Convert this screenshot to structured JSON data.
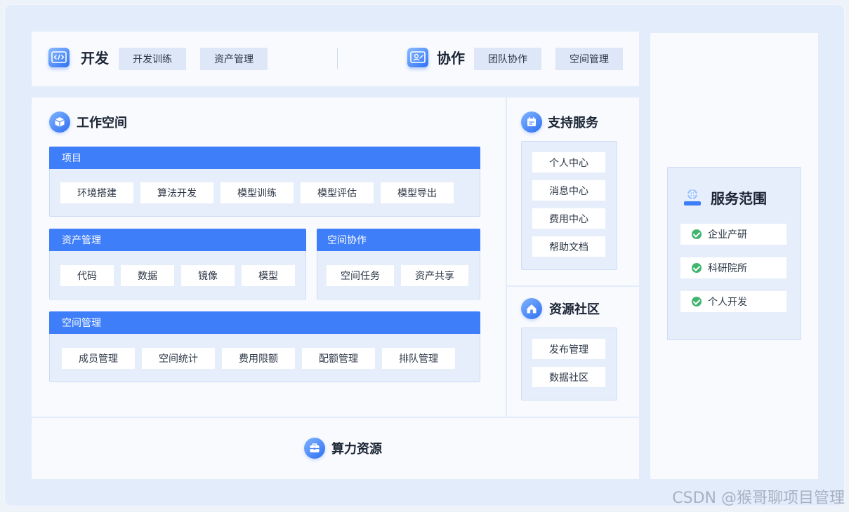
{
  "top_bar": {
    "develop": {
      "title": "开发",
      "chips": [
        "开发训练",
        "资产管理"
      ]
    },
    "collab": {
      "title": "协作",
      "chips": [
        "团队协作",
        "空间管理"
      ]
    }
  },
  "workspace": {
    "title": "工作空间",
    "project": {
      "header": "项目",
      "items": [
        "环境搭建",
        "算法开发",
        "模型训练",
        "模型评估",
        "模型导出"
      ]
    },
    "assets": {
      "header": "资产管理",
      "items": [
        "代码",
        "数据",
        "镜像",
        "模型"
      ]
    },
    "space_collab": {
      "header": "空间协作",
      "items": [
        "空间任务",
        "资产共享"
      ]
    },
    "space_mgmt": {
      "header": "空间管理",
      "items": [
        "成员管理",
        "空间统计",
        "费用限额",
        "配额管理",
        "排队管理"
      ]
    }
  },
  "support": {
    "title": "支持服务",
    "items": [
      "个人中心",
      "消息中心",
      "费用中心",
      "帮助文档"
    ]
  },
  "community": {
    "title": "资源社区",
    "items": [
      "发布管理",
      "数据社区"
    ]
  },
  "compute": {
    "title": "算力资源"
  },
  "scope": {
    "title": "服务范围",
    "items": [
      "企业产研",
      "科研院所",
      "个人开发"
    ]
  },
  "watermark": "CSDN @猴哥聊项目管理",
  "colors": {
    "accent": "#3e7ef8",
    "background": "#e3ecfb",
    "check": "#3fb56f"
  },
  "icons": {
    "develop": "code-window-icon",
    "collab": "user-card-icon",
    "workspace": "cube-icon",
    "support": "calendar-icon",
    "community": "home-icon",
    "compute": "toolbox-icon",
    "scope": "crosshair-icon",
    "scope_check": "check-icon"
  }
}
